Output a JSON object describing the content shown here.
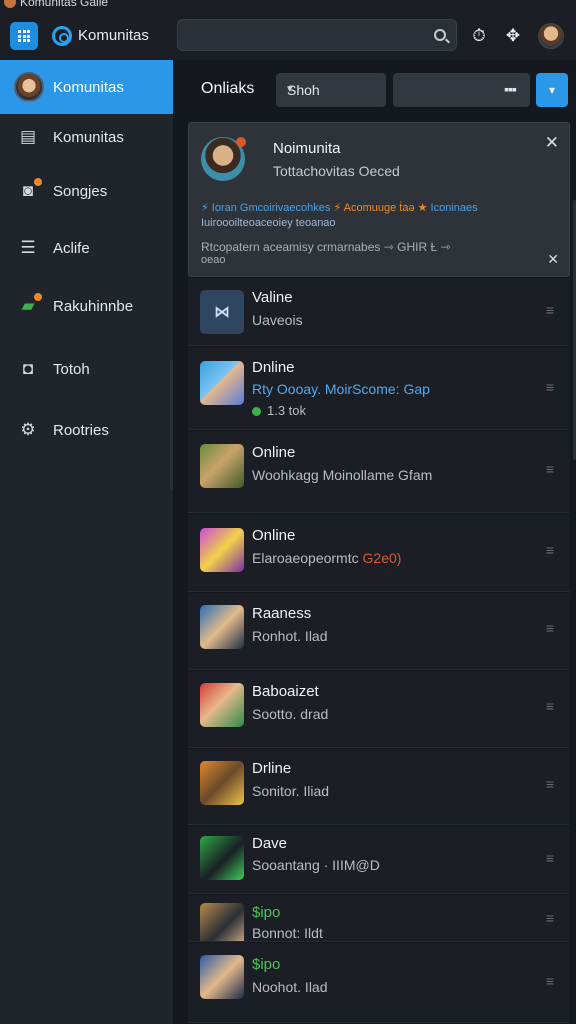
{
  "window": {
    "title": "Komunitas Gaile"
  },
  "header": {
    "app_name": "Komunitas",
    "search_placeholder": "",
    "icons": [
      "apps-grid-icon",
      "timer-icon",
      "gamepad-icon",
      "user-avatar"
    ]
  },
  "sidebar": {
    "items": [
      {
        "label": "Komunitas",
        "icon": "user-avatar",
        "active": true
      },
      {
        "label": "Komunitas",
        "icon": "inbox-icon",
        "active": false
      },
      {
        "label": "Songjes",
        "icon": "camera-icon",
        "active": false
      },
      {
        "label": "Aclife",
        "icon": "list-icon",
        "active": false
      },
      {
        "label": "Rakuhinnbe",
        "icon": "chat-icon",
        "active": false
      },
      {
        "label": "Totoh",
        "icon": "message-icon",
        "active": false
      },
      {
        "label": "Rootries",
        "icon": "gear-icon",
        "active": false
      }
    ]
  },
  "filter": {
    "title": "Onliaks",
    "select_value": "Shoh",
    "second_select_value": "",
    "chevron": "▾"
  },
  "notification": {
    "title": "Noimunita",
    "subtitle": "Tottachovitas Oeced",
    "line1_a": "⚡ Ioran Gmcoirivaecohkes",
    "line1_b": "⚡ Acomuuge ṫaə ★",
    "line1_c": "Iconinaes",
    "line2": "Iuiroooilteoaceoiey teoanao",
    "line3": "Rtcopatern aceamisy crmarnabes ⇾ GHIR Ƚ ⇾",
    "line4": "oeao",
    "close": "✕"
  },
  "rows": [
    {
      "title": "Valine",
      "subtitle": "Uaveois",
      "extra": ""
    },
    {
      "title": "Dnline",
      "subtitle": "Rty Oooay. MoirScome: Gap",
      "extra": "1.3 tok"
    },
    {
      "title": "Online",
      "subtitle": "Woohkagg Moinollame Gfam",
      "extra": ""
    },
    {
      "title": "Online",
      "subtitle": "Elaroaeopeormtc",
      "subtitle_red": "G2e0)",
      "extra": ""
    },
    {
      "title": "Raaness",
      "subtitle": "Ronhot. Ilad",
      "extra": ""
    },
    {
      "title": "Baboaizet",
      "subtitle": "Sootto. drad",
      "extra": ""
    },
    {
      "title": "Drline",
      "subtitle": "Sonitor. Iliad",
      "extra": ""
    },
    {
      "title": "Dave",
      "subtitle": "Sooantang · IIIM@D",
      "extra": ""
    },
    {
      "title": "$ipo",
      "subtitle": "Bonnot: Ildt",
      "extra": ""
    },
    {
      "title": "$ipo",
      "subtitle": "Noohot. Ilad",
      "extra": ""
    }
  ],
  "handle_glyph": "≡",
  "colors": {
    "accent": "#2b97e8",
    "online": "#3fb04a",
    "warning": "#f08a24",
    "sidebar": "#20252c",
    "background": "#15191f"
  }
}
